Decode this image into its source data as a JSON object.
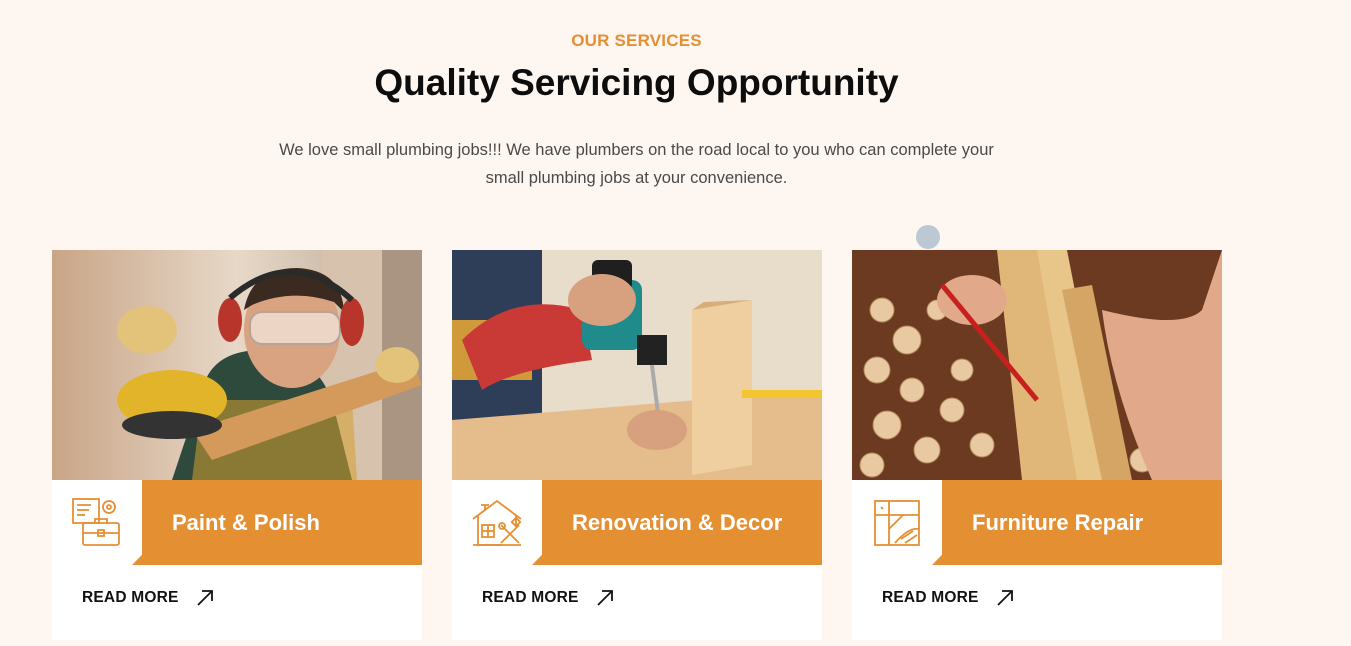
{
  "section": {
    "eyebrow": "OUR SERVICES",
    "title": "Quality Servicing Opportunity",
    "description": "We love small plumbing jobs!!! We have plumbers on the road local to you who can complete your small plumbing jobs at your convenience."
  },
  "colors": {
    "accent": "#e58f33",
    "background": "#fdf6f1",
    "card": "#ffffff"
  },
  "cards": [
    {
      "title": "Paint & Polish",
      "icon": "briefcase-tools-icon",
      "photo": "worker-sanding-wood-photo",
      "read_more": "READ MORE"
    },
    {
      "title": "Renovation & Decor",
      "icon": "house-tools-icon",
      "photo": "drilling-wood-photo",
      "read_more": "READ MORE"
    },
    {
      "title": "Furniture Repair",
      "icon": "blueprint-grid-icon",
      "photo": "measuring-wood-photo",
      "read_more": "READ MORE"
    }
  ]
}
